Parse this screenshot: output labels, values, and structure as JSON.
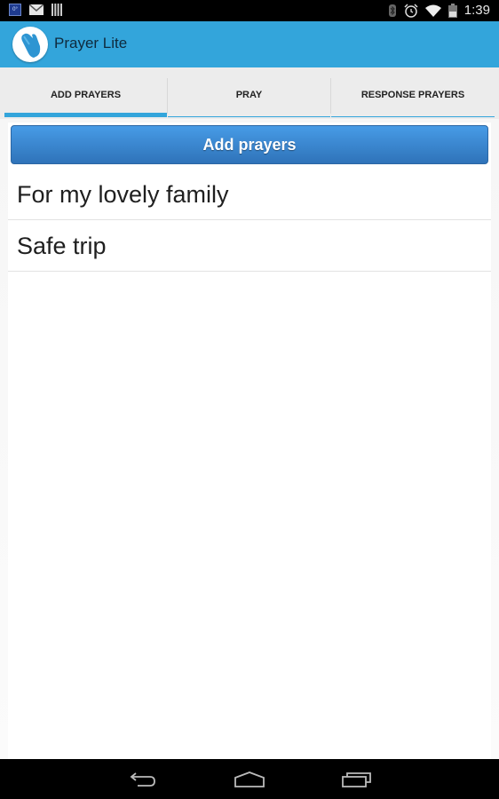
{
  "status_bar": {
    "time": "1:39",
    "weather_icon_text": "0°",
    "icons_left": [
      "weather-widget-icon",
      "gmail-icon",
      "signal-bars-icon"
    ],
    "icons_right": [
      "bluetooth-icon",
      "alarm-icon",
      "wifi-icon",
      "battery-charging-icon"
    ]
  },
  "action_bar": {
    "title": "Prayer Lite",
    "app_icon": "praying-hands-icon",
    "background_color": "#33a5db"
  },
  "tabs": [
    {
      "label": "ADD PRAYERS",
      "active": true
    },
    {
      "label": "PRAY",
      "active": false
    },
    {
      "label": "RESPONSE PRAYERS",
      "active": false
    }
  ],
  "main": {
    "add_button_label": "Add prayers",
    "prayers": [
      {
        "title": "For my lovely family"
      },
      {
        "title": "Safe trip"
      }
    ]
  },
  "nav_bar": {
    "buttons": [
      "back-icon",
      "home-icon",
      "recent-apps-icon"
    ]
  }
}
